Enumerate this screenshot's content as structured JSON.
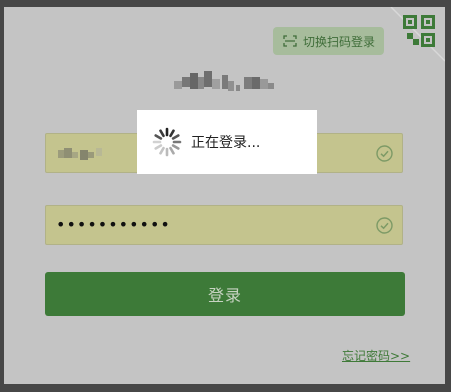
{
  "header": {
    "switch_label": "切换扫码登录"
  },
  "form": {
    "password_value": "•••••••••••",
    "login_label": "登录",
    "forgot_label": "忘记密码>>"
  },
  "loading": {
    "text": "正在登录..."
  },
  "icons": {
    "scan": "scan-frame-icon",
    "qr": "qr-code-icon",
    "check": "check-circle-icon",
    "spinner": "loading-spinner-icon"
  },
  "colors": {
    "panel_bg": "#c4c4c4",
    "outer_bg": "#474747",
    "accent_green": "#3d7a38",
    "input_fill": "#c4c48e",
    "switch_bg": "#a7bc9c"
  }
}
